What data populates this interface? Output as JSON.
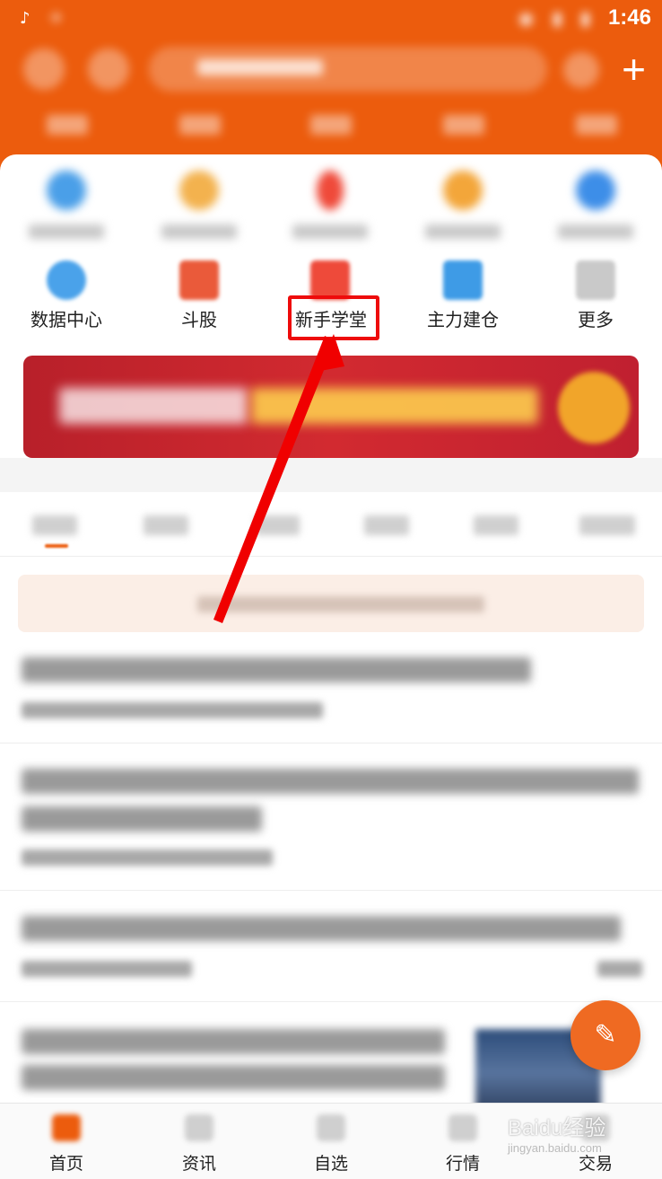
{
  "status_bar": {
    "time": "1:46"
  },
  "shortcuts_row2": [
    {
      "label": "数据中心",
      "icon": "data-center-icon"
    },
    {
      "label": "斗股",
      "icon": "stock-battle-icon"
    },
    {
      "label": "新手学堂",
      "icon": "beginner-school-icon"
    },
    {
      "label": "主力建仓",
      "icon": "main-force-icon"
    },
    {
      "label": "更多",
      "icon": "more-icon"
    }
  ],
  "bottom_nav": [
    {
      "label": "首页",
      "active": true
    },
    {
      "label": "资讯",
      "active": false
    },
    {
      "label": "自选",
      "active": false
    },
    {
      "label": "行情",
      "active": false
    },
    {
      "label": "交易",
      "active": false
    }
  ],
  "watermark": {
    "brand": "Baidu经验",
    "url": "jingyan.baidu.com"
  },
  "colors": {
    "brand": "#ec5c0d",
    "highlight": "#ee0b0b"
  }
}
